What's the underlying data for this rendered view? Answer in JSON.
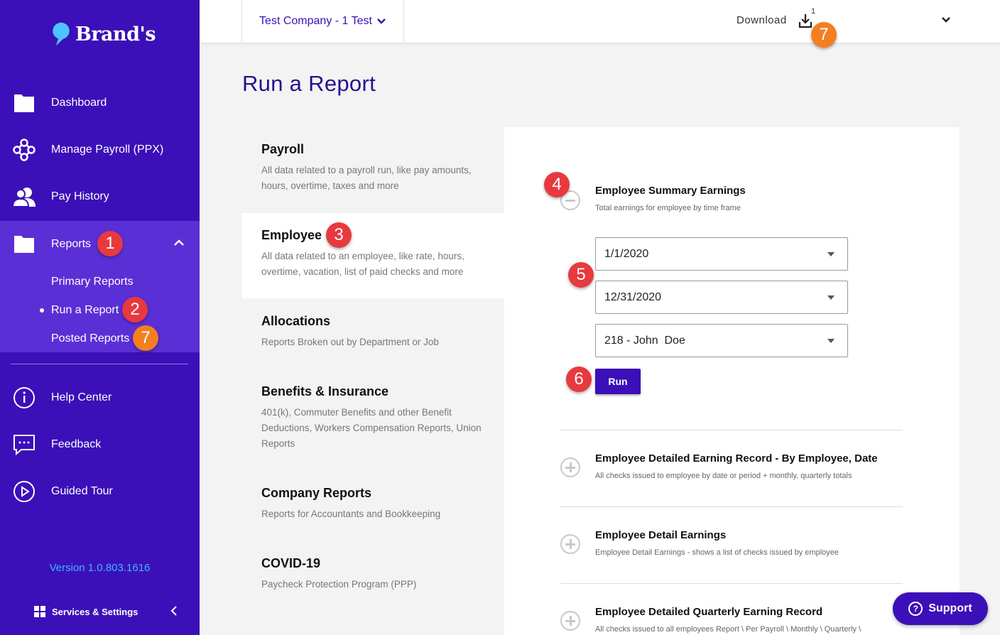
{
  "brand": {
    "name": "Brand's"
  },
  "sidebar": {
    "items": [
      {
        "label": "Dashboard",
        "icon": "folder-icon"
      },
      {
        "label": "Manage Payroll (PPX)",
        "icon": "network-icon"
      },
      {
        "label": "Pay History",
        "icon": "users-icon"
      },
      {
        "label": "Reports",
        "icon": "folder-icon"
      },
      {
        "label": "Help Center",
        "icon": "info-icon"
      },
      {
        "label": "Feedback",
        "icon": "chat-icon"
      },
      {
        "label": "Guided Tour",
        "icon": "play-icon"
      }
    ],
    "sub_items": [
      {
        "label": "Primary Reports"
      },
      {
        "label": "Run a Report"
      },
      {
        "label": "Posted Reports"
      }
    ],
    "version": "Version 1.0.803.1616",
    "services_label": "Services & Settings"
  },
  "topbar": {
    "company": "Test Company - 1 Test",
    "download_label": "Download",
    "download_count": "1"
  },
  "page": {
    "title": "Run a Report"
  },
  "categories": [
    {
      "title": "Payroll",
      "desc": "All data related to a payroll run, like pay amounts, hours, overtime, taxes and more"
    },
    {
      "title": "Employee",
      "desc": "All data related to an employee, like rate, hours, overtime, vacation, list of paid checks and more"
    },
    {
      "title": "Allocations",
      "desc": "Reports Broken out by Department or Job"
    },
    {
      "title": "Benefits & Insurance",
      "desc": "401(k), Commuter Benefits and other Benefit Deductions, Workers Compensation Reports, Union Reports"
    },
    {
      "title": "Company Reports",
      "desc": "Reports for Accountants and Bookkeeping"
    },
    {
      "title": "COVID-19",
      "desc": "Paycheck Protection Program (PPP)"
    }
  ],
  "reports": [
    {
      "title": "Employee Summary Earnings",
      "desc": "Total earnings for employee by time frame"
    },
    {
      "title": "Employee Detailed Earning Record - By Employee, Date",
      "desc": "All checks issued to employee by date or period + monthly, quarterly totals"
    },
    {
      "title": "Employee Detail Earnings",
      "desc": "Employee Detail Earnings - shows a list of checks issued by employee"
    },
    {
      "title": "Employee Detailed Quarterly Earning Record",
      "desc": "All checks issued to all employees Report \\ Per Payroll \\ Monthly \\ Quarterly \\"
    }
  ],
  "form": {
    "start_date": "1/1/2020",
    "end_date": "12/31/2020",
    "employee": "218 - John  Doe",
    "run_label": "Run"
  },
  "badges": [
    "1",
    "2",
    "3",
    "4",
    "5",
    "6",
    "7"
  ],
  "support_label": "Support",
  "colors": {
    "sidebar": "#3b10b8",
    "sidebar_active": "#5b2fd6",
    "badge_red": "#e8393f",
    "badge_orange": "#f37f20",
    "version": "#3fb6ff"
  }
}
